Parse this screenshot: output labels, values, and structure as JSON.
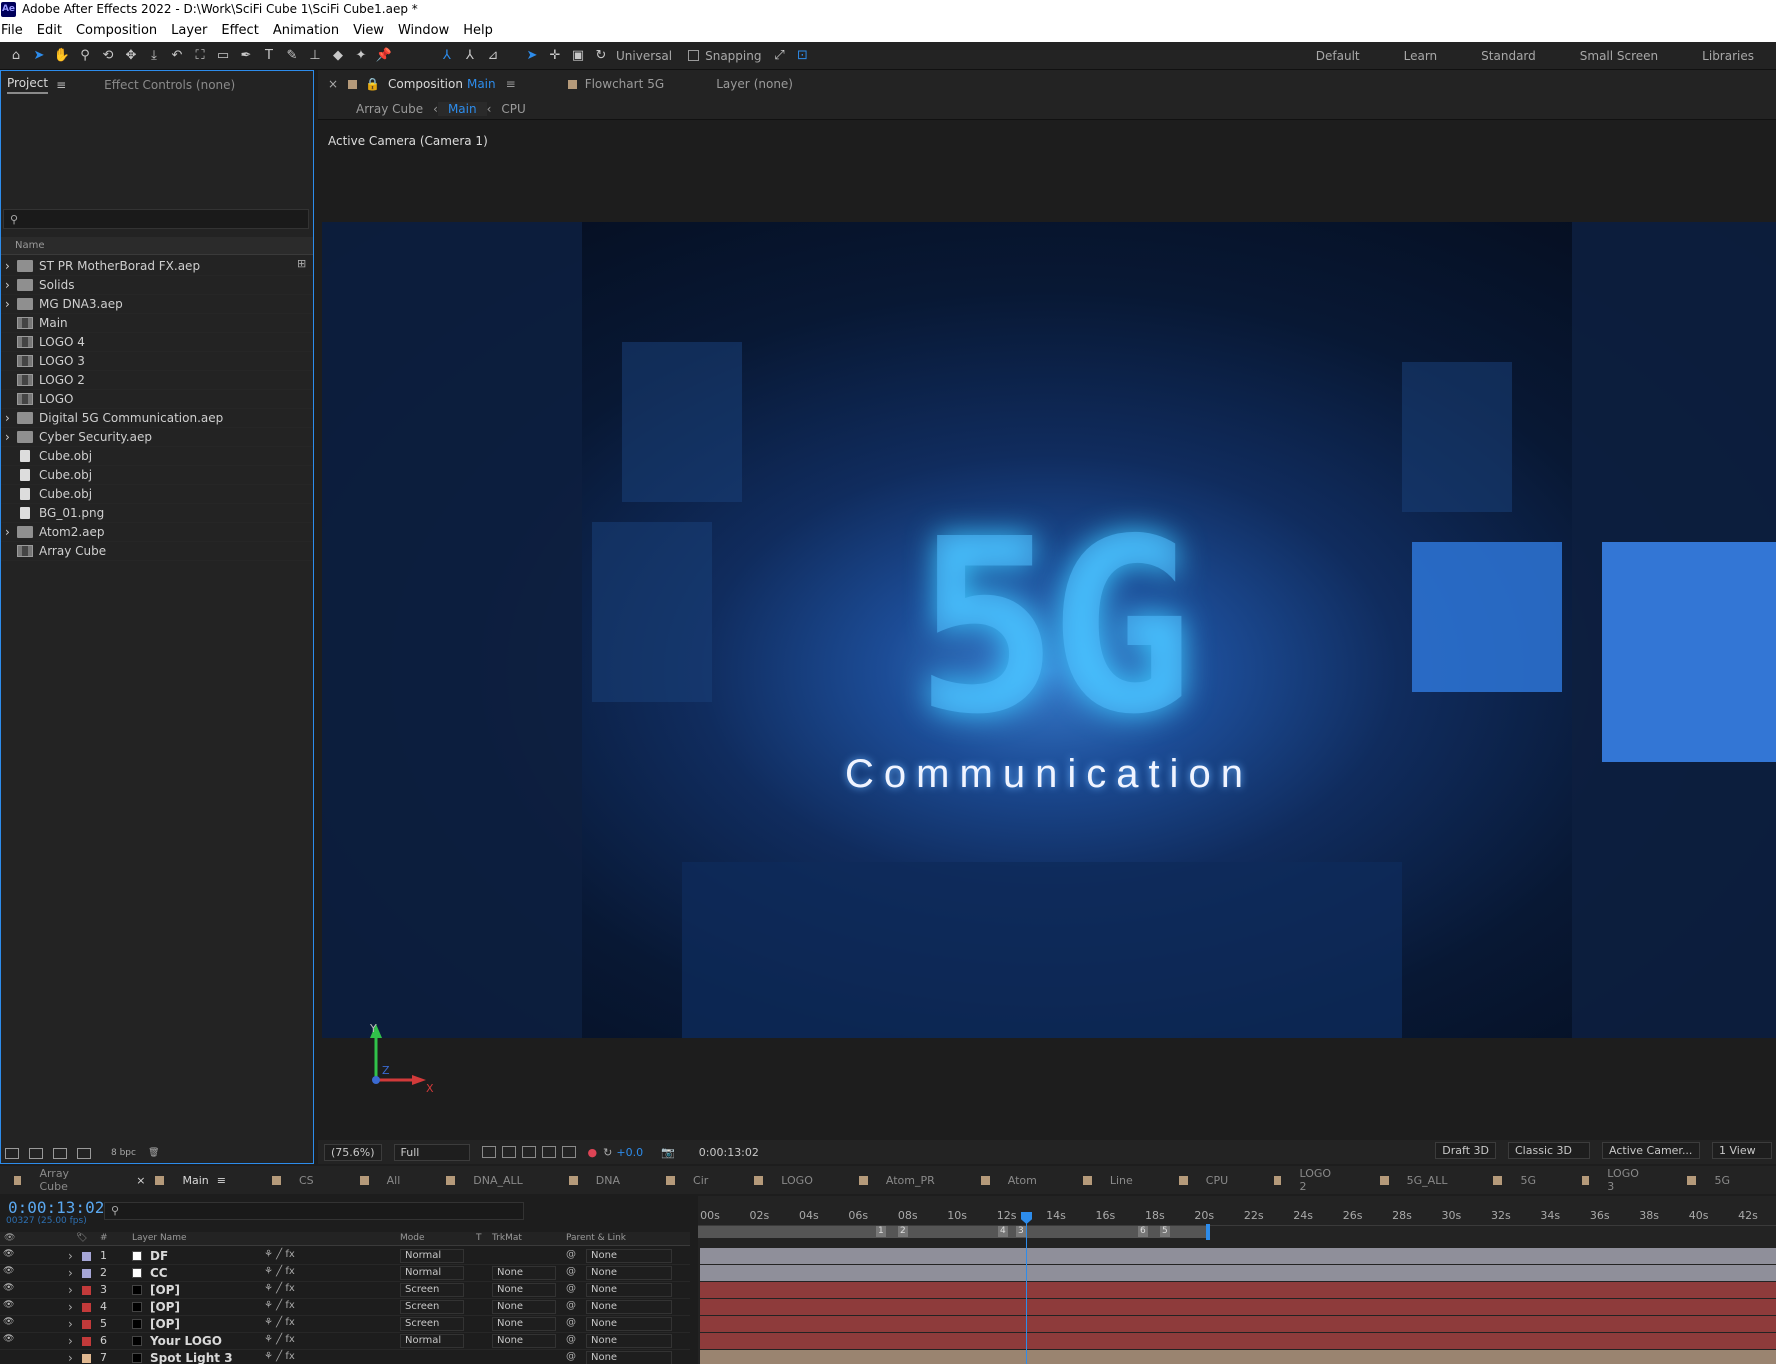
{
  "app": {
    "title": "Adobe After Effects 2022 - D:\\Work\\SciFi Cube 1\\SciFi Cube1.aep *",
    "logo": "Ae"
  },
  "menu": [
    "File",
    "Edit",
    "Composition",
    "Layer",
    "Effect",
    "Animation",
    "View",
    "Window",
    "Help"
  ],
  "toolbar": {
    "axis_mode": "Universal",
    "snapping_label": "Snapping",
    "workspaces": [
      "Default",
      "Learn",
      "Standard",
      "Small Screen",
      "Libraries"
    ]
  },
  "project_panel": {
    "tabs": [
      "Project",
      "Effect Controls (none)"
    ],
    "search_placeholder": "",
    "column_name": "Name",
    "items": [
      {
        "name": "ST PR MotherBorad FX.aep",
        "type": "folder"
      },
      {
        "name": "Solids",
        "type": "folder"
      },
      {
        "name": "MG DNA3.aep",
        "type": "folder"
      },
      {
        "name": "Main",
        "type": "comp"
      },
      {
        "name": "LOGO 4",
        "type": "comp"
      },
      {
        "name": "LOGO 3",
        "type": "comp"
      },
      {
        "name": "LOGO 2",
        "type": "comp"
      },
      {
        "name": "LOGO",
        "type": "comp"
      },
      {
        "name": "Digital 5G Communication.aep",
        "type": "folder"
      },
      {
        "name": "Cyber Security.aep",
        "type": "folder"
      },
      {
        "name": "Cube.obj",
        "type": "file"
      },
      {
        "name": "Cube.obj",
        "type": "file"
      },
      {
        "name": "Cube.obj",
        "type": "file"
      },
      {
        "name": "BG_01.png",
        "type": "file"
      },
      {
        "name": "Atom2.aep",
        "type": "folder"
      },
      {
        "name": "Array Cube",
        "type": "comp"
      }
    ],
    "bit_depth": "8 bpc"
  },
  "comp_panel": {
    "tabs": [
      {
        "label": "Composition",
        "name": "Main"
      },
      {
        "label": "Flowchart",
        "name": "5G"
      },
      {
        "label": "Layer",
        "name": "(none)"
      }
    ],
    "breadcrumb": [
      "Array Cube",
      "Main",
      "CPU"
    ],
    "camera_label": "Active Camera (Camera 1)",
    "viewer_text": {
      "big": "5G",
      "caption": "Communication"
    },
    "axes": {
      "y": "Y",
      "z": "Z",
      "x": "X"
    },
    "viewer_bar": {
      "zoom": "(75.6%)",
      "resolution": "Full",
      "exposure": "+0.0",
      "timecode": "0:00:13:02",
      "draft3d": "Draft 3D",
      "renderer": "Classic 3D",
      "camera": "Active Camer...",
      "views": "1 View"
    }
  },
  "timeline": {
    "tabs": [
      "Array Cube",
      "Main",
      "CS",
      "All",
      "DNA_ALL",
      "DNA",
      "Cir",
      "LOGO",
      "Atom_PR",
      "Atom",
      "Line",
      "CPU",
      "LOGO 2",
      "5G_ALL",
      "5G",
      "LOGO 3",
      "5G"
    ],
    "active_tab": "Main",
    "timecode": "0:00:13:02",
    "frame_info": "00327 (25.00 fps)",
    "columns": {
      "number": "#",
      "layer_name": "Layer Name",
      "mode": "Mode",
      "t": "T",
      "trkmat": "TrkMat",
      "parent": "Parent & Link"
    },
    "ruler_ticks": [
      "00s",
      "02s",
      "04s",
      "06s",
      "08s",
      "10s",
      "12s",
      "14s",
      "16s",
      "18s",
      "20s",
      "22s",
      "24s",
      "26s",
      "28s",
      "30s",
      "32s",
      "34s",
      "36s",
      "38s",
      "40s",
      "42s"
    ],
    "markers": [
      "1",
      "2",
      "4",
      "3",
      "6",
      "5"
    ],
    "layers": [
      {
        "num": "1",
        "name": "DF",
        "mode": "Normal",
        "trkmat": "",
        "parent": "None",
        "label_color": "#a6a6d6",
        "track_color": "#8f8f9a"
      },
      {
        "num": "2",
        "name": "CC",
        "mode": "Normal",
        "trkmat": "None",
        "parent": "None",
        "label_color": "#a6a6d6",
        "track_color": "#8f8f9a"
      },
      {
        "num": "3",
        "name": "[OP]",
        "mode": "Screen",
        "trkmat": "None",
        "parent": "None",
        "label_color": "#c23a3a",
        "track_color": "#8e3b3b"
      },
      {
        "num": "4",
        "name": "[OP]",
        "mode": "Screen",
        "trkmat": "None",
        "parent": "None",
        "label_color": "#c23a3a",
        "track_color": "#8e3b3b"
      },
      {
        "num": "5",
        "name": "[OP]",
        "mode": "Screen",
        "trkmat": "None",
        "parent": "None",
        "label_color": "#c23a3a",
        "track_color": "#8e3b3b"
      },
      {
        "num": "6",
        "name": "Your LOGO",
        "mode": "Normal",
        "trkmat": "None",
        "parent": "None",
        "label_color": "#c23a3a",
        "track_color": "#8e3b3b"
      },
      {
        "num": "7",
        "name": "Spot Light 3",
        "mode": "",
        "trkmat": "",
        "parent": "None",
        "label_color": "#e0b890",
        "track_color": "#9a8470"
      }
    ]
  }
}
